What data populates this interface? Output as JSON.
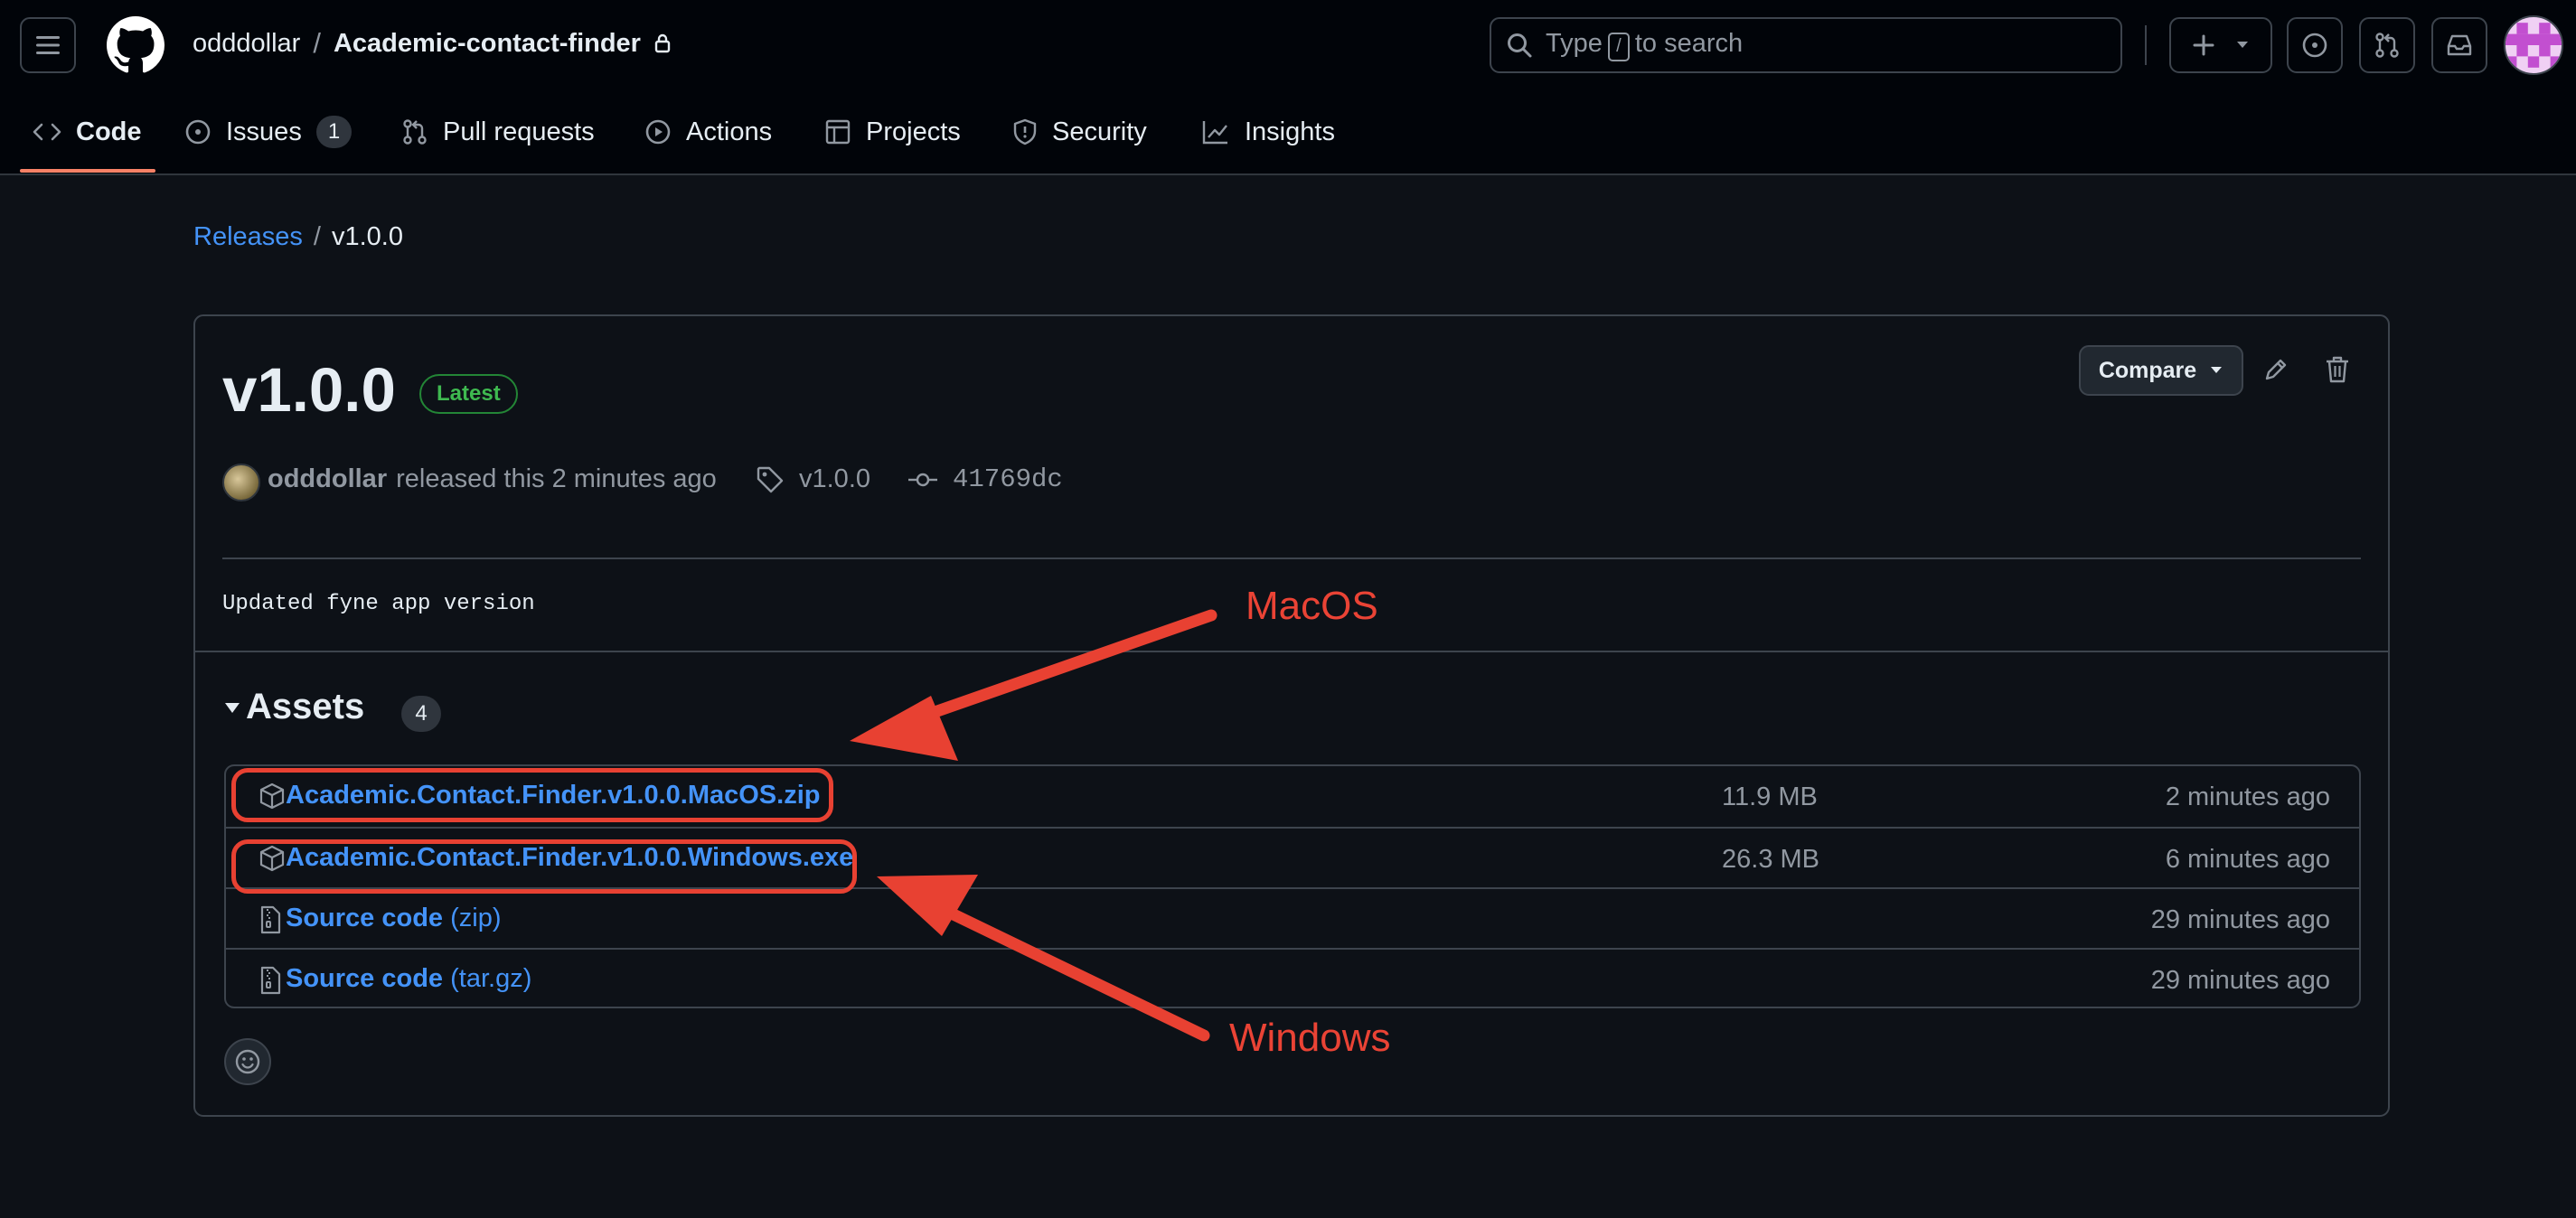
{
  "header": {
    "owner": "odddollar",
    "separator": "/",
    "repo": "Academic-contact-finder",
    "search": {
      "prefix": "Type",
      "key": "/",
      "suffix": "to search"
    },
    "icons": [
      "hamburger-icon",
      "github-logo-icon",
      "lock-icon",
      "search-icon",
      "plus-icon",
      "triangle-down-icon",
      "issue-circle-icon",
      "pull-request-icon",
      "inbox-icon",
      "avatar"
    ]
  },
  "nav": {
    "tabs": [
      {
        "label": "Code",
        "icon": "code-icon",
        "active": true
      },
      {
        "label": "Issues",
        "icon": "issue-icon",
        "count": "1"
      },
      {
        "label": "Pull requests",
        "icon": "pull-request-icon"
      },
      {
        "label": "Actions",
        "icon": "play-icon"
      },
      {
        "label": "Projects",
        "icon": "table-icon"
      },
      {
        "label": "Security",
        "icon": "shield-icon"
      },
      {
        "label": "Insights",
        "icon": "graph-icon"
      }
    ]
  },
  "breadcrumb": {
    "parent": "Releases",
    "separator": "/",
    "current": "v1.0.0"
  },
  "release": {
    "title": "v1.0.0",
    "badge": "Latest",
    "compare_label": "Compare",
    "author": "odddollar",
    "released_text": "released this 2 minutes ago",
    "tag": "v1.0.0",
    "commit": "41769dc",
    "notes": "Updated fyne app version"
  },
  "assets": {
    "title": "Assets",
    "count": "4",
    "items": [
      {
        "name": "Academic.Contact.Finder.v1.0.0.MacOS.zip",
        "sub": "",
        "size": "11.9 MB",
        "time": "2 minutes ago",
        "icon": "package-icon"
      },
      {
        "name": "Academic.Contact.Finder.v1.0.0.Windows.exe",
        "sub": "",
        "size": "26.3 MB",
        "time": "6 minutes ago",
        "icon": "package-icon"
      },
      {
        "name": "Source code",
        "sub": "(zip)",
        "size": "",
        "time": "29 minutes ago",
        "icon": "file-zip-icon"
      },
      {
        "name": "Source code",
        "sub": "(tar.gz)",
        "size": "",
        "time": "29 minutes ago",
        "icon": "file-zip-icon"
      }
    ]
  },
  "annotations": {
    "macos": "MacOS",
    "windows": "Windows",
    "color": "#ea4335"
  },
  "colors": {
    "link": "#4493f8",
    "background": "#0d1117",
    "header": "#010409",
    "latest": "#3fb950",
    "active_tab": "#f78166"
  }
}
